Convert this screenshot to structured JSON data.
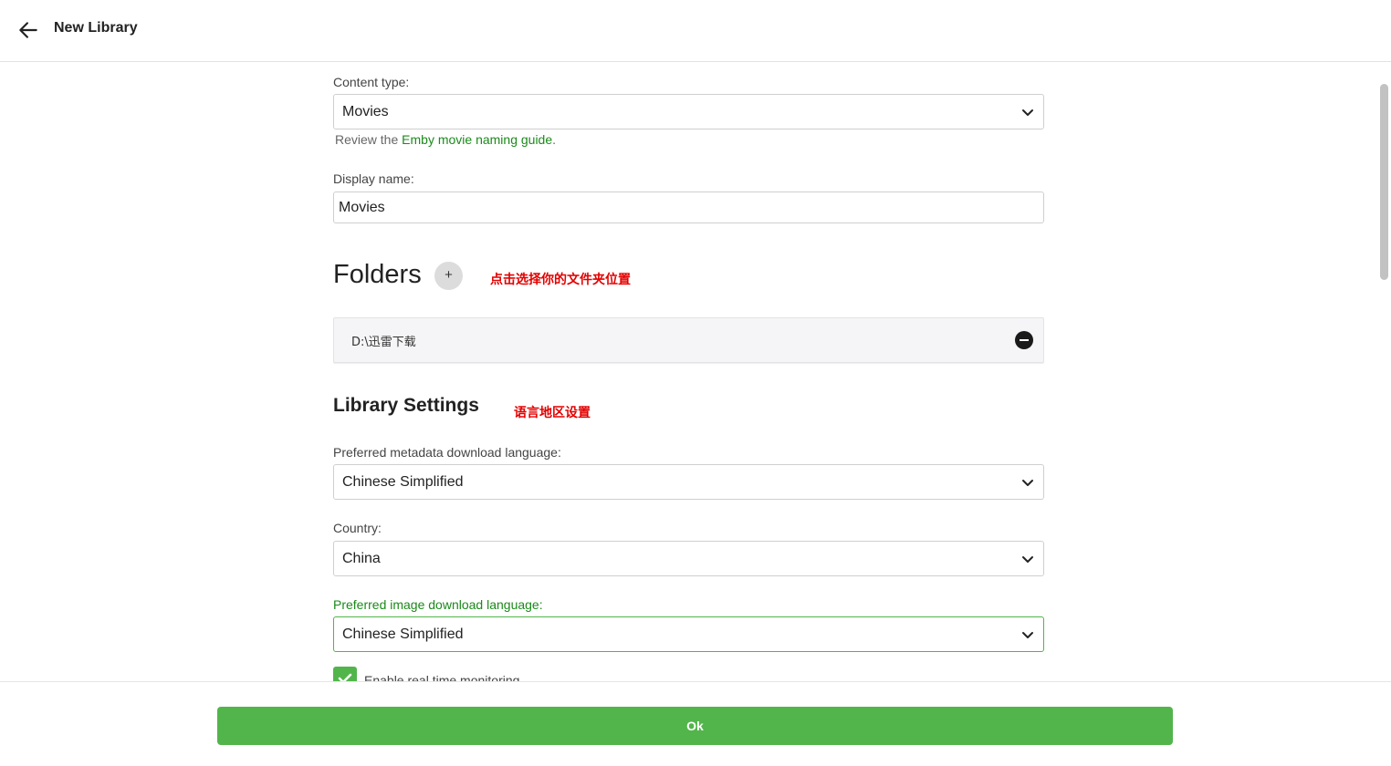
{
  "header": {
    "title": "New Library",
    "back_icon": "arrow-left-icon"
  },
  "form": {
    "content_type": {
      "label": "Content type:",
      "value": "Movies"
    },
    "naming_guide": {
      "prefix": "Review the ",
      "link": "Emby movie naming guide",
      "suffix": "."
    },
    "display_name": {
      "label": "Display name:",
      "value": "Movies"
    },
    "folders": {
      "heading": "Folders",
      "add_label": "+",
      "annotation": "点击选择你的文件夹位置",
      "items": [
        {
          "path": "D:\\迅雷下载"
        }
      ]
    },
    "library_settings": {
      "heading": "Library Settings",
      "annotation": "语言地区设置"
    },
    "metadata_language": {
      "label": "Preferred metadata download language:",
      "value": "Chinese Simplified"
    },
    "country": {
      "label": "Country:",
      "value": "China"
    },
    "image_language": {
      "label": "Preferred image download language:",
      "value": "Chinese Simplified"
    },
    "realtime_monitoring": {
      "label": "Enable real time monitoring",
      "checked": true
    }
  },
  "footer": {
    "ok_label": "Ok"
  },
  "colors": {
    "accent": "#52b54b",
    "link": "#1a8a1a",
    "annotation": "#e30000"
  }
}
